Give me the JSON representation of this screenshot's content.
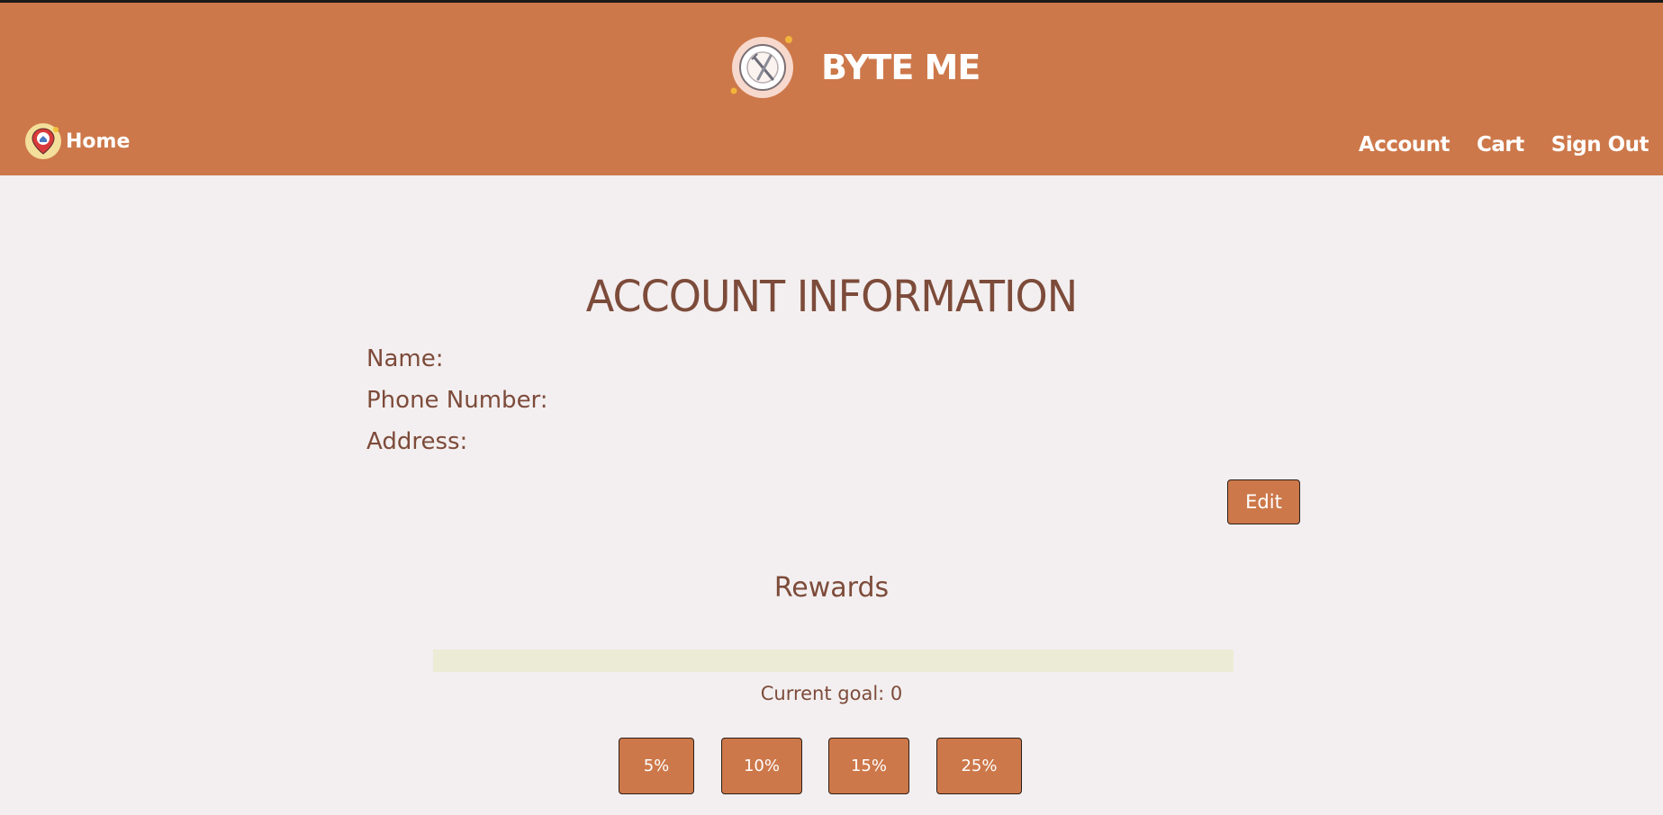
{
  "header": {
    "brand_title": "BYTE ME",
    "brand_logo_icon": "plate-fork-knife-icon",
    "home_label": "Home",
    "home_icon": "location-pin-home-icon",
    "nav": {
      "account": "Account",
      "cart": "Cart",
      "sign_out": "Sign Out"
    }
  },
  "account": {
    "title": "ACCOUNT INFORMATION",
    "name_label": "Name:",
    "phone_label": "Phone Number:",
    "address_label": "Address:",
    "edit_label": "Edit"
  },
  "rewards": {
    "title": "Rewards",
    "progress_fraction": 0,
    "goal_text": "Current goal: 0",
    "buttons": [
      "5%",
      "10%",
      "15%",
      "25%"
    ]
  },
  "colors": {
    "accent": "#cd784a",
    "text_brown": "#7d4b3a",
    "page_background": "#f3eff0",
    "progress_track": "#ecebd5"
  }
}
